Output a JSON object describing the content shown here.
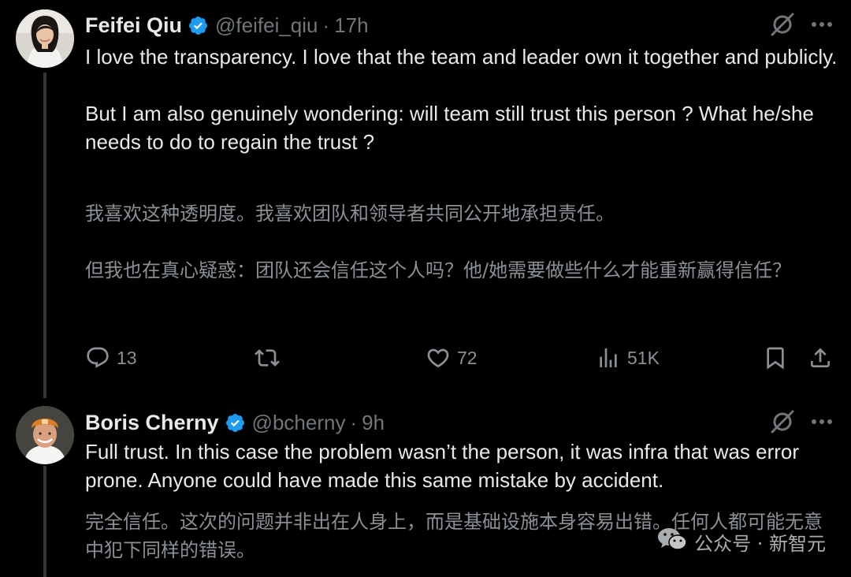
{
  "tweets": [
    {
      "author": {
        "display_name": "Feifei Qiu",
        "handle": "@feifei_qiu",
        "verified": true
      },
      "separator": "·",
      "timestamp": "17h",
      "text": "I love the transparency. I love that the team and leader own it together and publicly.\n\nBut I am also genuinely wondering: will team still trust this person ? What he/she needs to do to regain the trust ?",
      "translation": "我喜欢这种透明度。我喜欢团队和领导者共同公开地承担责任。\n\n但我也在真心疑惑：团队还会信任这个人吗？他/她需要做些什么才能重新赢得信任？",
      "stats": {
        "replies": "13",
        "reposts": "",
        "likes": "72",
        "views": "51K"
      }
    },
    {
      "author": {
        "display_name": "Boris Cherny",
        "handle": "@bcherny",
        "verified": true
      },
      "separator": "·",
      "timestamp": "9h",
      "text": "Full trust. In this case the problem wasn’t the person, it was infra that was error prone. Anyone could have made this same mistake by accident.",
      "translation": "完全信任。这次的问题并非出在人身上，而是基础设施本身容易出错。任何人都可能无意中犯下同样的错误。"
    }
  ],
  "watermark": {
    "text": "公众号 · 新智元",
    "icon": "wechat-icon"
  },
  "icons": {
    "verified": "verified-badge-icon",
    "grok": "grok-icon",
    "more": "more-icon",
    "reply": "reply-icon",
    "repost": "repost-icon",
    "like": "like-icon",
    "views": "views-icon",
    "bookmark": "bookmark-icon",
    "share": "share-icon"
  },
  "colors": {
    "background": "#000000",
    "text_primary": "#e7e9ea",
    "text_secondary": "#71767b",
    "translation_text": "#8b9096",
    "verified_blue": "#1d9bf0",
    "thread_line": "#333639"
  }
}
